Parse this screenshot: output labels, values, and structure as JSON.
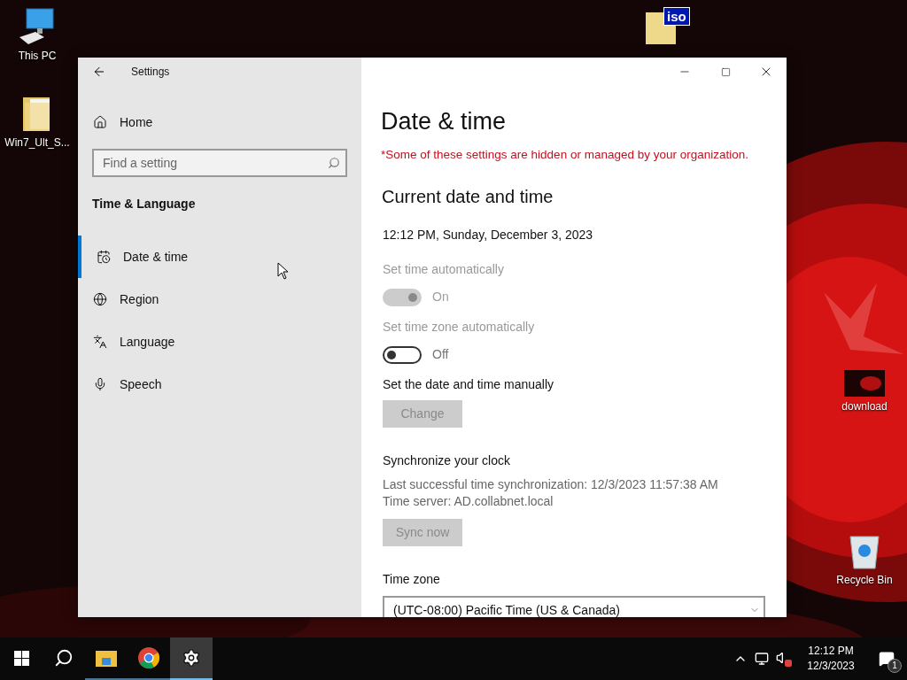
{
  "desktop_icons": [
    {
      "kind": "pc",
      "label": "This PC"
    },
    {
      "kind": "folder",
      "label": "Win7_Ult_S..."
    },
    {
      "kind": "iso",
      "badge": "iso"
    },
    {
      "kind": "video",
      "label": "download"
    },
    {
      "kind": "bin",
      "label": "Recycle Bin"
    }
  ],
  "window": {
    "title": "Settings",
    "sidebar": {
      "home": "Home",
      "search": {
        "placeholder": "Find a setting"
      },
      "section": "Time & Language",
      "items": [
        {
          "label": "Date & time",
          "selected": true
        },
        {
          "label": "Region",
          "selected": false
        },
        {
          "label": "Language",
          "selected": false
        },
        {
          "label": "Speech",
          "selected": false
        }
      ]
    },
    "content": {
      "title": "Date & time",
      "notice": "*Some of these settings are hidden or managed by your organization.",
      "heading": "Current date and time",
      "current": "12:12 PM, Sunday, December 3, 2023",
      "toggles": [
        {
          "label": "Set time automatically",
          "on": true,
          "disabled": true,
          "state_text": "On"
        },
        {
          "label": "Set time zone automatically",
          "on": false,
          "disabled": false,
          "state_text": "Off"
        }
      ],
      "manual": {
        "label": "Set the date and time manually",
        "button": "Change",
        "disabled": true
      },
      "sync": {
        "heading": "Synchronize your clock",
        "lines": [
          "Last successful time synchronization: 12/3/2023 11:57:38 AM",
          "Time server: AD.collabnet.local"
        ],
        "button": "Sync now",
        "disabled": true
      },
      "time_zone": {
        "label": "Time zone",
        "value": "(UTC-08:00) Pacific Time (US & Canada)"
      }
    }
  },
  "taskbar": {
    "apps": [
      {
        "kind": "start",
        "active": false
      },
      {
        "kind": "search",
        "active": false
      },
      {
        "kind": "explorer",
        "active": false
      },
      {
        "kind": "chrome",
        "active": false
      },
      {
        "kind": "settings",
        "active": true
      }
    ],
    "clock": {
      "time": "12:12 PM",
      "date": "12/3/2023"
    },
    "notifications": "1"
  }
}
